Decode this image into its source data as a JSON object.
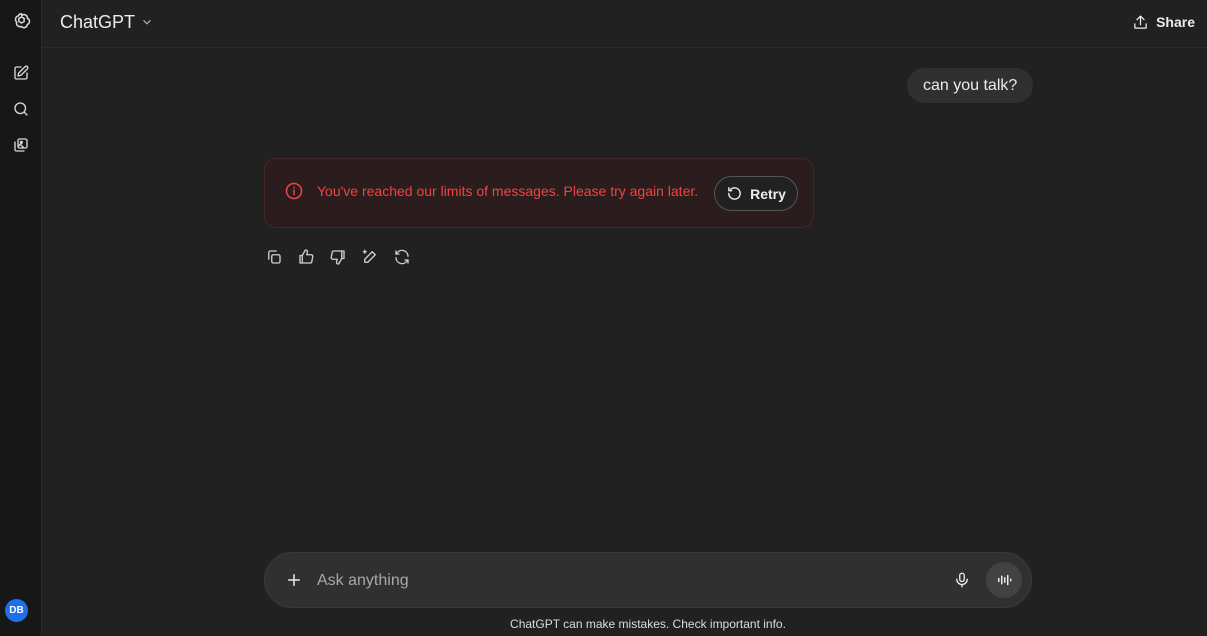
{
  "app": {
    "accent_color": "#1f6feb",
    "error_color": "#ef4444"
  },
  "sidebar": {
    "logo_icon": "openai-logo-icon",
    "items": [
      {
        "icon": "new-chat-icon"
      },
      {
        "icon": "search-icon"
      },
      {
        "icon": "library-icon"
      }
    ],
    "avatar_initials": "DB"
  },
  "header": {
    "model_name": "ChatGPT",
    "model_chevron_icon": "chevron-down-icon",
    "share_label": "Share",
    "share_icon": "share-icon"
  },
  "conversation": {
    "user_message": "can you talk?",
    "error": {
      "icon": "alert-circle-icon",
      "text": "You've reached our limits of messages. Please try again later.",
      "retry_label": "Retry",
      "retry_icon": "retry-icon"
    },
    "actions": [
      {
        "icon": "copy-icon"
      },
      {
        "icon": "thumbs-up-icon"
      },
      {
        "icon": "thumbs-down-icon"
      },
      {
        "icon": "edit-canvas-icon"
      },
      {
        "icon": "regenerate-icon"
      }
    ]
  },
  "composer": {
    "placeholder": "Ask anything",
    "value": "",
    "attach_icon": "plus-icon",
    "mic_icon": "microphone-icon",
    "voice_icon": "voice-mode-icon"
  },
  "footer": {
    "disclaimer": "ChatGPT can make mistakes. Check important info."
  }
}
